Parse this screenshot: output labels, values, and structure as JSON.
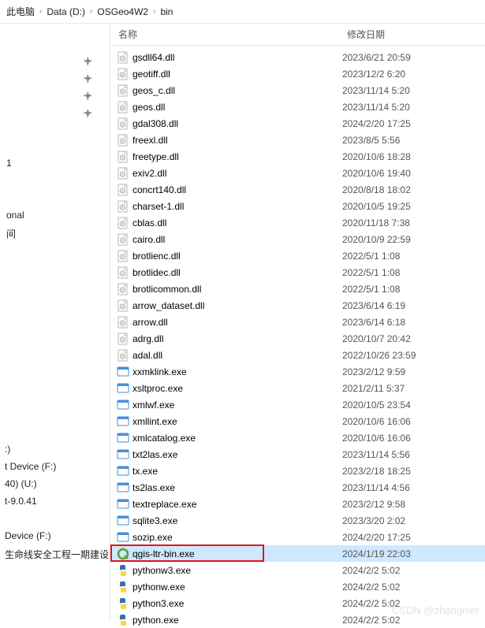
{
  "breadcrumb": [
    "此电脑",
    "Data (D:)",
    "OSGeo4W2",
    "bin"
  ],
  "columns": {
    "name": "名称",
    "date": "修改日期"
  },
  "left": {
    "stubs_top": [
      "1",
      "onal",
      "间"
    ],
    "stubs_mid": [
      ":)",
      "t Device (F:)",
      "40) (U:)",
      "t-9.0.41"
    ],
    "stubs_bot": [
      "Device (F:)",
      "生命线安全工程一期建设"
    ]
  },
  "files": [
    {
      "name": "gsdll64.dll",
      "date": "2023/6/21 20:59",
      "type": "dll"
    },
    {
      "name": "geotiff.dll",
      "date": "2023/12/2 6:20",
      "type": "dll"
    },
    {
      "name": "geos_c.dll",
      "date": "2023/11/14 5:20",
      "type": "dll"
    },
    {
      "name": "geos.dll",
      "date": "2023/11/14 5:20",
      "type": "dll"
    },
    {
      "name": "gdal308.dll",
      "date": "2024/2/20 17:25",
      "type": "dll"
    },
    {
      "name": "freexl.dll",
      "date": "2023/8/5 5:56",
      "type": "dll"
    },
    {
      "name": "freetype.dll",
      "date": "2020/10/6 18:28",
      "type": "dll"
    },
    {
      "name": "exiv2.dll",
      "date": "2020/10/6 19:40",
      "type": "dll"
    },
    {
      "name": "concrt140.dll",
      "date": "2020/8/18 18:02",
      "type": "dll"
    },
    {
      "name": "charset-1.dll",
      "date": "2020/10/5 19:25",
      "type": "dll"
    },
    {
      "name": "cblas.dll",
      "date": "2020/11/18 7:38",
      "type": "dll"
    },
    {
      "name": "cairo.dll",
      "date": "2020/10/9 22:59",
      "type": "dll"
    },
    {
      "name": "brotlienc.dll",
      "date": "2022/5/1 1:08",
      "type": "dll"
    },
    {
      "name": "brotlidec.dll",
      "date": "2022/5/1 1:08",
      "type": "dll"
    },
    {
      "name": "brotlicommon.dll",
      "date": "2022/5/1 1:08",
      "type": "dll"
    },
    {
      "name": "arrow_dataset.dll",
      "date": "2023/6/14 6:19",
      "type": "dll"
    },
    {
      "name": "arrow.dll",
      "date": "2023/6/14 6:18",
      "type": "dll"
    },
    {
      "name": "adrg.dll",
      "date": "2020/10/7 20:42",
      "type": "dll"
    },
    {
      "name": "adal.dll",
      "date": "2022/10/26 23:59",
      "type": "dll"
    },
    {
      "name": "xxmklink.exe",
      "date": "2023/2/12 9:59",
      "type": "exe"
    },
    {
      "name": "xsltproc.exe",
      "date": "2021/2/11 5:37",
      "type": "exe"
    },
    {
      "name": "xmlwf.exe",
      "date": "2020/10/5 23:54",
      "type": "exe"
    },
    {
      "name": "xmllint.exe",
      "date": "2020/10/6 16:06",
      "type": "exe"
    },
    {
      "name": "xmlcatalog.exe",
      "date": "2020/10/6 16:06",
      "type": "exe"
    },
    {
      "name": "txt2las.exe",
      "date": "2023/11/14 5:56",
      "type": "exe"
    },
    {
      "name": "tx.exe",
      "date": "2023/2/18 18:25",
      "type": "exe"
    },
    {
      "name": "ts2las.exe",
      "date": "2023/11/14 4:56",
      "type": "exe"
    },
    {
      "name": "textreplace.exe",
      "date": "2023/2/12 9:58",
      "type": "exe"
    },
    {
      "name": "sqlite3.exe",
      "date": "2023/3/20 2:02",
      "type": "exe"
    },
    {
      "name": "sozip.exe",
      "date": "2024/2/20 17:25",
      "type": "exe"
    },
    {
      "name": "qgis-ltr-bin.exe",
      "date": "2024/1/19 22:03",
      "type": "qgis",
      "highlighted": true
    },
    {
      "name": "pythonw3.exe",
      "date": "2024/2/2 5:02",
      "type": "py"
    },
    {
      "name": "pythonw.exe",
      "date": "2024/2/2 5:02",
      "type": "py"
    },
    {
      "name": "python3.exe",
      "date": "2024/2/2 5:02",
      "type": "py"
    },
    {
      "name": "python.exe",
      "date": "2024/2/2 5:02",
      "type": "py"
    }
  ],
  "watermark": "CSDN @zhangiser"
}
